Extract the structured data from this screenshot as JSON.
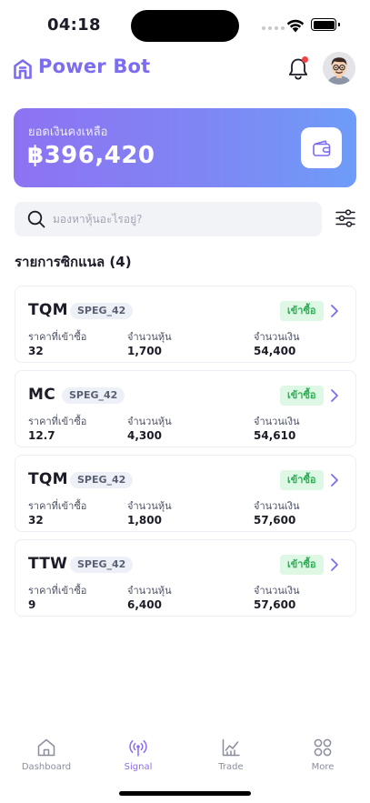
{
  "status_bar": {
    "time": "04:18"
  },
  "header": {
    "brand": "Power Bot"
  },
  "balance": {
    "label": "ยอดเงินคงเหลือ",
    "value": "฿396,420"
  },
  "search": {
    "placeholder": "มองหาหุ้นอะไรอยู่?"
  },
  "signals": {
    "title": "รายการซิกแนล (4)",
    "col_price": "ราคาที่เข้าซื้อ",
    "col_shares": "จำนวนหุ้น",
    "col_amount": "จำนวนเงิน",
    "items": [
      {
        "symbol": "TQM",
        "strategy": "SPEG_42",
        "action": "เข้าซื้อ",
        "price": "32",
        "shares": "1,700",
        "amount": "54,400"
      },
      {
        "symbol": "MC",
        "strategy": "SPEG_42",
        "action": "เข้าซื้อ",
        "price": "12.7",
        "shares": "4,300",
        "amount": "54,610"
      },
      {
        "symbol": "TQM",
        "strategy": "SPEG_42",
        "action": "เข้าซื้อ",
        "price": "32",
        "shares": "1,800",
        "amount": "57,600"
      },
      {
        "symbol": "TTW",
        "strategy": "SPEG_42",
        "action": "เข้าซื้อ",
        "price": "9",
        "shares": "6,400",
        "amount": "57,600"
      }
    ]
  },
  "nav": {
    "items": [
      {
        "label": "Dashboard",
        "icon": "home-icon"
      },
      {
        "label": "Signal",
        "icon": "signal-icon"
      },
      {
        "label": "Trade",
        "icon": "chart-icon"
      },
      {
        "label": "More",
        "icon": "grid-icon"
      }
    ],
    "active": "Signal"
  },
  "colors": {
    "brand": "#7b6cf0",
    "buy_badge_bg": "#dff7e5",
    "buy_badge_text": "#2cb155",
    "notification_dot": "#ef4444"
  }
}
